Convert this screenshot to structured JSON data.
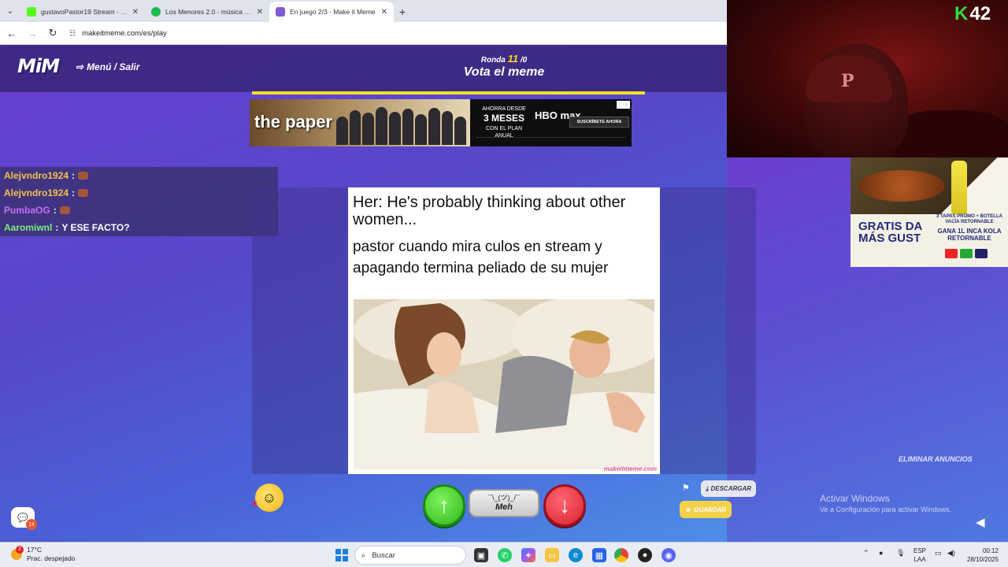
{
  "browser": {
    "tabs": [
      {
        "title": "gustavoPastor19 Stream - Watc",
        "icon_color": "#53fc18",
        "active": false
      },
      {
        "title": "Los Menores 2.0 - música y letr",
        "icon_color": "#1db954",
        "active": false
      },
      {
        "title": "En juego 2/3 - Make it Meme",
        "icon_color": "#7b5bd6",
        "active": true
      }
    ],
    "url": "makeitmeme.com/es/play"
  },
  "game": {
    "logo": "MiM",
    "menu_label": "Menú / Salir",
    "round_label": "Ronda",
    "round_number": "11",
    "round_suffix": "/0",
    "phase_title": "Vota el meme",
    "progress": 1.0,
    "remove_ads": "ELIMINAR ANUNCIOS",
    "download_label": "DESCARGAR",
    "save_label": "GUARDAR",
    "meh_face": "¯\\_(ツ)_/¯",
    "meh_label": "Meh"
  },
  "meme": {
    "top_text": "Her: He's probably thinking about other women...",
    "caption": "pastor cuando mira culos en stream y apagando termina peliado de su mujer",
    "watermark": "makeitmeme.com"
  },
  "top_ad": {
    "brand": "the paper",
    "offer_line1": "AHORRA DESDE",
    "offer_big": "3 MESES",
    "offer_line2": "CON EL PLAN ANUAL",
    "logo": "HBO max",
    "cta": "SUSCRÍBETE AHORA"
  },
  "chat": [
    {
      "user": "Alejvndro1924",
      "message": "",
      "color": "#f2c14e"
    },
    {
      "user": "Alejvndro1924",
      "message": "",
      "color": "#f2c14e"
    },
    {
      "user": "PumbaOG",
      "message": "",
      "color": "#c86cf0"
    },
    {
      "user": "Aaromiwnl",
      "message": "Y ESE FACTO?",
      "color": "#7cf07a"
    }
  ],
  "side_ad": {
    "headline": "GRATIS DA MÁS GUST",
    "promo_small": "3 TAPAS PROMO + BOTELLA VACÍA RETORNABLE",
    "promo_big": "GANA 1L INCA KOLA RETORNABLE"
  },
  "overlay": {
    "k42_letter": "K",
    "k42_number": "42",
    "chat_count": "14"
  },
  "watermark": {
    "line1": "Activar Windows",
    "line2": "Ve a Configuración para activar Windows."
  },
  "taskbar": {
    "weather_badge": "2",
    "temperature": "17°C",
    "condition": "Prac. despejado",
    "search_placeholder": "Buscar",
    "lang1": "ESP",
    "lang2": "LAA",
    "time": "00:12",
    "date": "28/10/2025"
  }
}
